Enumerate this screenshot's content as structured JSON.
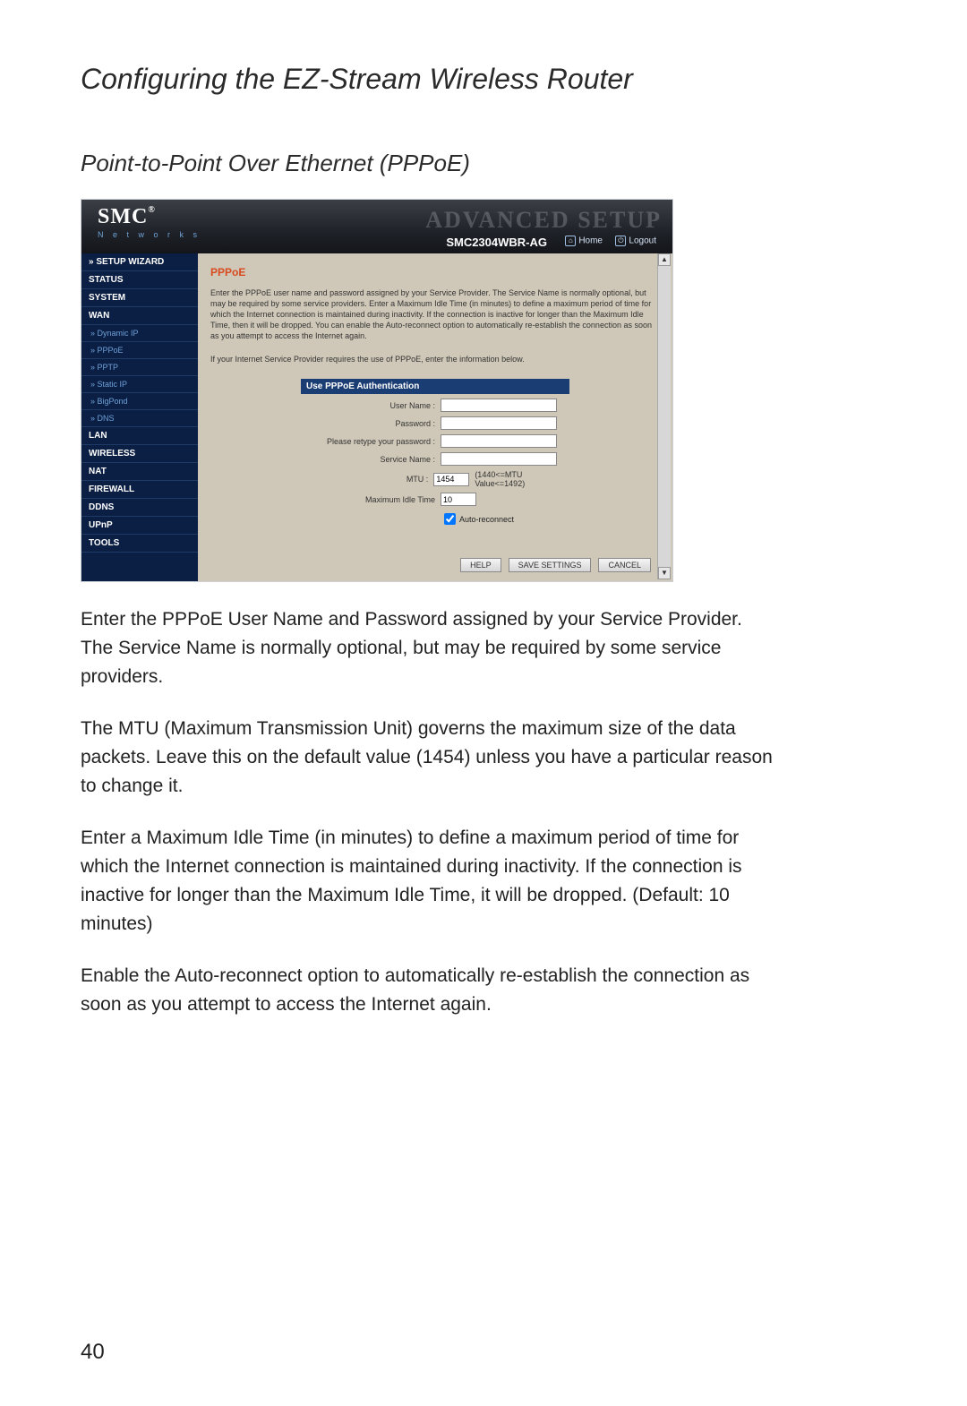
{
  "doc": {
    "title": "Configuring the EZ-Stream Wireless Router",
    "section": "Point-to-Point Over Ethernet (PPPoE)",
    "page_number": "40",
    "paragraphs": {
      "p1": "Enter the PPPoE User Name and Password assigned by your Service Provider. The Service Name is normally optional, but may be required by some service providers.",
      "p2": "The MTU (Maximum Transmission Unit) governs the maximum size of the data packets. Leave this on the default value (1454) unless you have a particular reason to change it.",
      "p3": "Enter a Maximum Idle Time (in minutes) to define a maximum period of time for which the Internet connection is maintained during inactivity. If the connection is inactive for longer than the Maximum Idle Time, it will be dropped. (Default: 10 minutes)",
      "p4": "Enable the Auto-reconnect option to automatically re-establish the connection as soon as you attempt to access the Internet again."
    }
  },
  "ui": {
    "brand": "SMC",
    "brand_sub": "N e t w o r k s",
    "advanced": "ADVANCED SETUP",
    "model": "SMC2304WBR-AG",
    "topnav": {
      "home": "Home",
      "logout": "Logout"
    },
    "sidebar": [
      {
        "label": "» SETUP WIZARD",
        "major": true
      },
      {
        "label": "STATUS",
        "major": true
      },
      {
        "label": "SYSTEM",
        "major": true
      },
      {
        "label": "WAN",
        "major": true
      },
      {
        "label": "» Dynamic IP",
        "sub": true
      },
      {
        "label": "» PPPoE",
        "sub": true
      },
      {
        "label": "» PPTP",
        "sub": true
      },
      {
        "label": "» Static IP",
        "sub": true
      },
      {
        "label": "» BigPond",
        "sub": true
      },
      {
        "label": "» DNS",
        "sub": true
      },
      {
        "label": "LAN",
        "major": true
      },
      {
        "label": "WIRELESS",
        "major": true
      },
      {
        "label": "NAT",
        "major": true
      },
      {
        "label": "FIREWALL",
        "major": true
      },
      {
        "label": "DDNS",
        "major": true
      },
      {
        "label": "UPnP",
        "major": true
      },
      {
        "label": "TOOLS",
        "major": true
      }
    ],
    "content": {
      "heading": "PPPoE",
      "intro": "Enter the PPPoE user name and password assigned by your Service Provider. The Service Name is normally optional, but may be required by some service providers.  Enter a Maximum Idle Time (in minutes) to define a maximum period of time for which the Internet connection is maintained during inactivity.  If the connection is inactive for longer than the Maximum Idle Time, then it will be dropped.  You can enable the Auto-reconnect option to automatically re-establish the connection as soon as you attempt to access the Internet again.",
      "intro2": "If your Internet Service Provider requires the use of PPPoE, enter the information below.",
      "form_header": "Use PPPoE Authentication",
      "rows": {
        "user": "User Name :",
        "pass": "Password :",
        "pass2": "Please retype your password :",
        "svc": "Service Name :",
        "mtu": "MTU :",
        "mtu_value": "1454",
        "mtu_note": "(1440<=MTU Value<=1492)",
        "idle": "Maximum Idle Time",
        "idle_value": "10",
        "auto": "Auto-reconnect"
      },
      "buttons": {
        "help": "HELP",
        "save": "SAVE SETTINGS",
        "cancel": "CANCEL"
      }
    }
  }
}
